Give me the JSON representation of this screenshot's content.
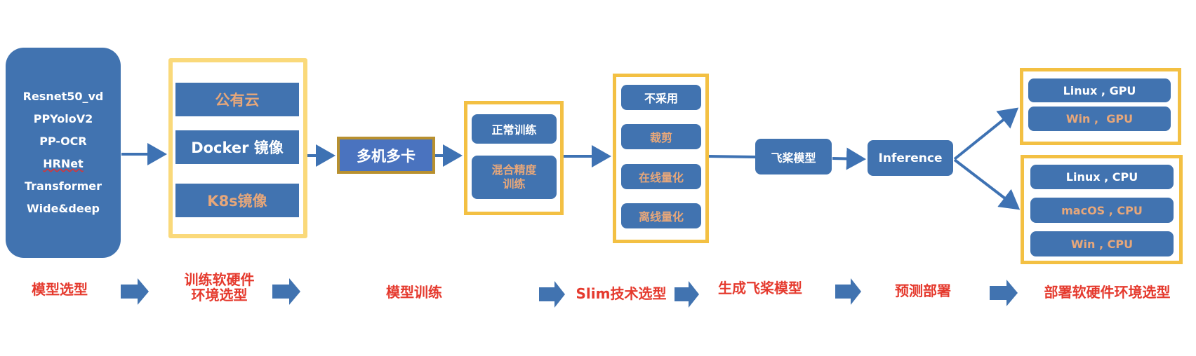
{
  "stages": {
    "model_selection": {
      "models": [
        "Resnet50_vd",
        "PPYoloV2",
        "PP-OCR",
        "HRNet",
        "Transformer",
        "Wide&deep"
      ]
    },
    "train_env": {
      "items": [
        "公有云",
        "Docker 镜像",
        "K8s镜像"
      ]
    },
    "multi_device": {
      "label": "多机多卡"
    },
    "training": {
      "items": [
        "正常训练",
        "混合精度\n训练"
      ]
    },
    "slim": {
      "items": [
        "不采用",
        "裁剪",
        "在线量化",
        "离线量化"
      ]
    },
    "paddle_model": {
      "label": "飞桨模型"
    },
    "inference": {
      "label": "Inference"
    },
    "deploy_gpu": {
      "items": [
        "Linux , GPU",
        "Win ,  GPU"
      ]
    },
    "deploy_cpu": {
      "items": [
        "Linux , CPU",
        "macOS , CPU",
        "Win , CPU"
      ]
    }
  },
  "bottom_labels": [
    "模型选型",
    "训练软硬件\n环境选型",
    "模型训练",
    "Slim技术选型",
    "生成飞桨模型",
    "预测部署",
    "部署软硬件环境选型"
  ],
  "colors": {
    "box_blue": "#4173b0",
    "highlight_yellow": "#f3c043",
    "label_red": "#e53a2e",
    "secondary_text_orange": "#e7a77a"
  }
}
